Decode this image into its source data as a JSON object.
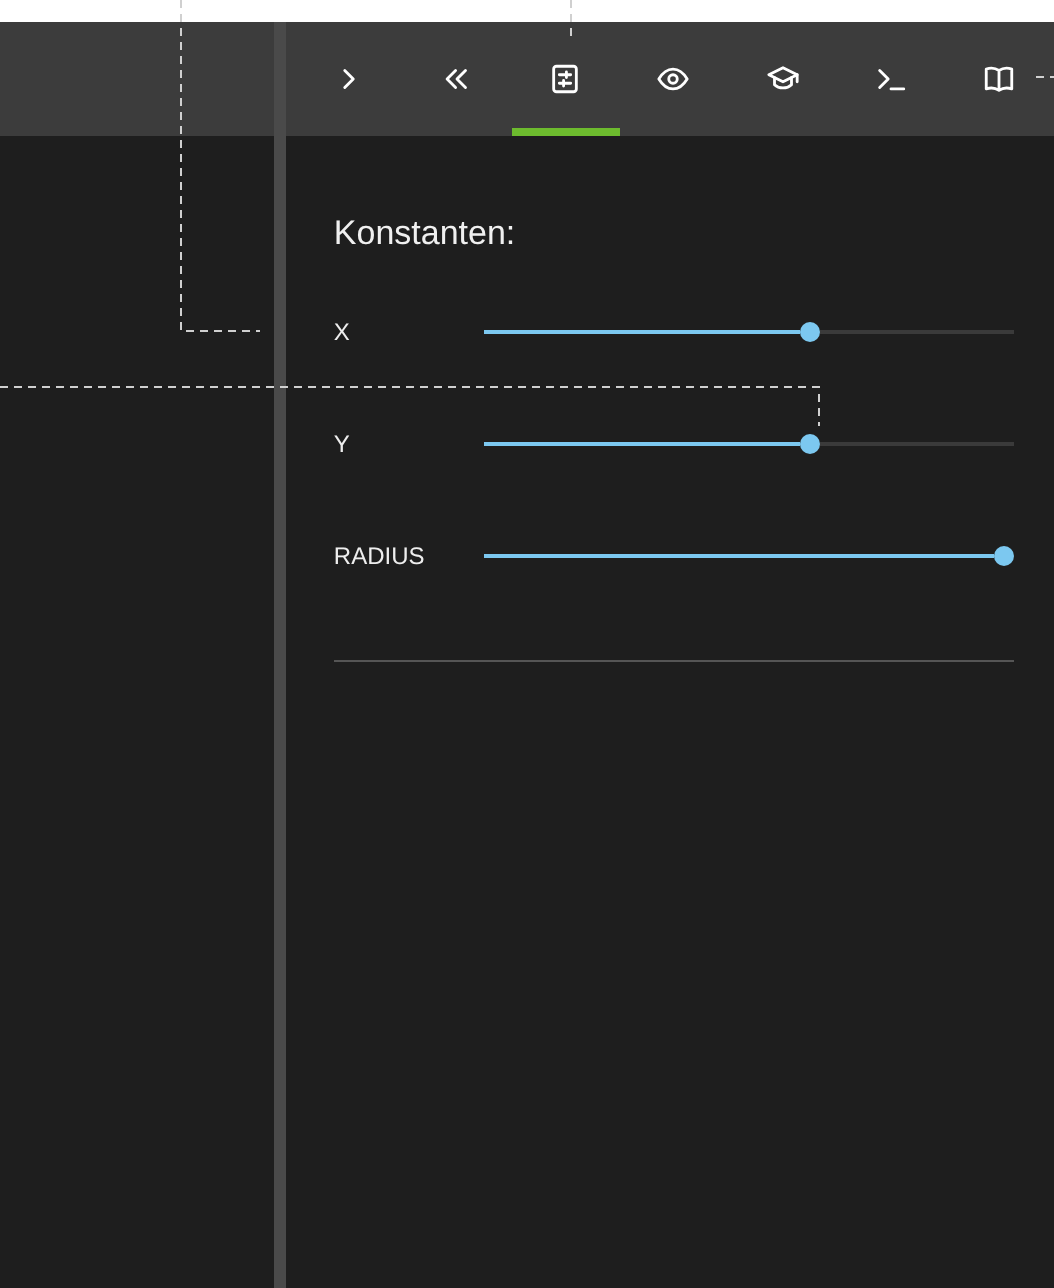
{
  "toolbar": {
    "tabs": [
      {
        "kind": "chevron-right",
        "selected": false
      },
      {
        "kind": "double-chevron-left",
        "selected": false
      },
      {
        "kind": "sliders",
        "selected": true
      },
      {
        "kind": "eye",
        "selected": false
      },
      {
        "kind": "graduation-cap",
        "selected": false
      },
      {
        "kind": "terminal",
        "selected": false
      },
      {
        "kind": "book",
        "selected": false
      }
    ]
  },
  "panel": {
    "heading": "Konstanten:",
    "sliders": [
      {
        "label": "X",
        "level": 0.62
      },
      {
        "label": "Y",
        "level": 0.62
      },
      {
        "label": "RADIUS",
        "level": 1.0
      }
    ]
  }
}
